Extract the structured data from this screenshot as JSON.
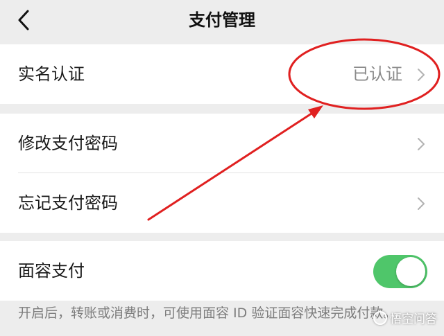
{
  "nav": {
    "title": "支付管理",
    "back_icon": "chevron-left-icon"
  },
  "groups": [
    {
      "rows": [
        {
          "label": "实名认证",
          "value": "已认证",
          "icon": "chevron-right-icon"
        }
      ]
    },
    {
      "rows": [
        {
          "label": "修改支付密码",
          "icon": "chevron-right-icon"
        },
        {
          "label": "忘记支付密码",
          "icon": "chevron-right-icon"
        }
      ]
    },
    {
      "rows": [
        {
          "label": "面容支付",
          "toggle_on": true
        }
      ]
    }
  ],
  "note": "开启后，转账或消费时，可使用面容 ID 验证面容快速完成付款。",
  "watermark": "悟空问答",
  "colors": {
    "background": "#ededed",
    "toggle_on": "#4fc66a",
    "annotation": "#e02020"
  }
}
